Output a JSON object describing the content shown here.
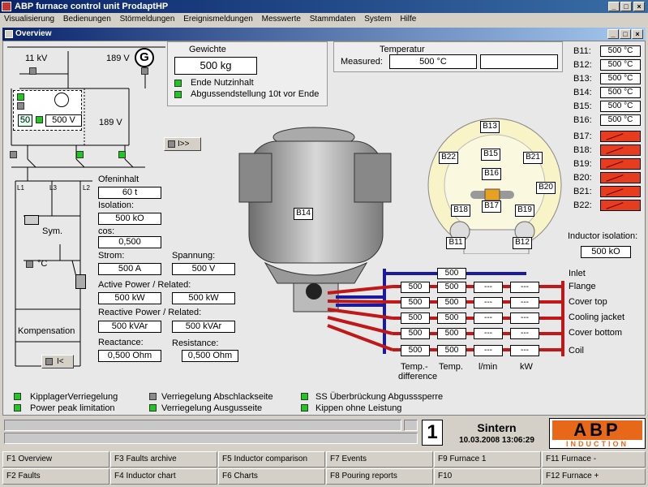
{
  "window": {
    "title": "ABP furnace control unit  ProdaptHP"
  },
  "menu": [
    "Visualisierung",
    "Bedienungen",
    "Störmeldungen",
    "Ereignismeldungen",
    "Messwerte",
    "Stammdaten",
    "System",
    "Hilfe"
  ],
  "child_window": {
    "title": "Overview"
  },
  "gewichte": {
    "title": "Gewichte",
    "value": "500 kg",
    "items": [
      "Ende Nutzinhalt",
      "Abgussendstellung 10t vor Ende"
    ]
  },
  "temperatur": {
    "title": "Temperatur",
    "measured_label": "Measured:",
    "value": "500   °C",
    "extra": ""
  },
  "electrical": {
    "voltage_11kv": "11  kV",
    "voltage_189v_top": "189 V",
    "generator": "G",
    "tap": "50",
    "tap_voltage": "500  V",
    "voltage_189v": "189 V",
    "arrow_btn": "I>>",
    "sym": "Sym.",
    "celsius": "°C",
    "kompensation": "Kompensation",
    "ik_btn": "I<",
    "l1": "L1",
    "l3": "L3",
    "l2": "L2"
  },
  "readings": {
    "ofeninhalt_label": "Ofeninhalt",
    "ofeninhalt": "60 t",
    "isolation_label": "Isolation:",
    "isolation": "500 kO",
    "cos_label": "cos:",
    "cos": "0,500",
    "strom_label": "Strom:",
    "strom": "500 A",
    "spannung_label": "Spannung:",
    "spannung": "500 V",
    "active_label": "Active Power / Related:",
    "active1": "500 kW",
    "active2": "500 kW",
    "reactive_label": "Reactive Power / Related:",
    "reactive1": "500 kVAr",
    "reactive2": "500 kVAr",
    "reactance_label": "Reactance:",
    "reactance": "0,500 Ohm",
    "resistance_label": "Resistance:",
    "resistance": "0,500 Ohm"
  },
  "furnace": {
    "label": "B14"
  },
  "top_view": {
    "sensors": [
      "B13",
      "B22",
      "B15",
      "B21",
      "B16",
      "B20",
      "B17",
      "B18",
      "B19",
      "B11",
      "B12"
    ]
  },
  "b_temps": {
    "ok": [
      {
        "name": "B11:",
        "value": "500 °C"
      },
      {
        "name": "B12:",
        "value": "500 °C"
      },
      {
        "name": "B13:",
        "value": "500 °C"
      },
      {
        "name": "B14:",
        "value": "500 °C"
      },
      {
        "name": "B15:",
        "value": "500 °C"
      },
      {
        "name": "B16:",
        "value": "500 °C"
      }
    ],
    "fault": [
      "B17:",
      "B18:",
      "B19:",
      "B20:",
      "B21:",
      "B22:"
    ],
    "fault_color": "#e83c1e"
  },
  "inductor_isolation": {
    "label": "Inductor isolation:",
    "value": "500 kO"
  },
  "cooling": {
    "inlet": {
      "label": "Inlet",
      "value": "500"
    },
    "rows": [
      {
        "label": "Flange",
        "diff": "500",
        "temp": "500",
        "flow": "---",
        "kw": "---"
      },
      {
        "label": "Cover top",
        "diff": "500",
        "temp": "500",
        "flow": "---",
        "kw": "---"
      },
      {
        "label": "Cooling jacket",
        "diff": "500",
        "temp": "500",
        "flow": "---",
        "kw": "---"
      },
      {
        "label": "Cover bottom",
        "diff": "500",
        "temp": "500",
        "flow": "---",
        "kw": "---"
      },
      {
        "label": "Coil",
        "diff": "500",
        "temp": "500",
        "flow": "---",
        "kw": "---"
      }
    ],
    "headers": {
      "diff1": "Temp.-",
      "diff2": "difference",
      "temp": "Temp.",
      "flow": "l/min",
      "kw": "kW"
    }
  },
  "status": {
    "col1": [
      "KipplagerVerriegelung",
      "Power peak limitation"
    ],
    "col2": [
      "Verriegelung Abschlackseite",
      "Verriegelung Ausgusseite"
    ],
    "col3": [
      "SS Überbrückung Abgusssperre",
      "Kippen ohne Leistung"
    ]
  },
  "footer": {
    "number": "1",
    "mode": "Sintern",
    "datetime": "10.03.2008 13:06:29",
    "logo_top": "ABP",
    "logo_bottom": "INDUCTION"
  },
  "fkeys": [
    [
      "F1 Overview",
      "F3 Faults archive",
      "F5 Inductor comparison",
      "F7 Events",
      "F9 Furnace 1",
      "F11 Furnace -"
    ],
    [
      "F2 Faults",
      "F4 Inductor chart",
      "F6 Charts",
      "F8 Pouring reports",
      "F10",
      "F12 Furnace +"
    ]
  ]
}
